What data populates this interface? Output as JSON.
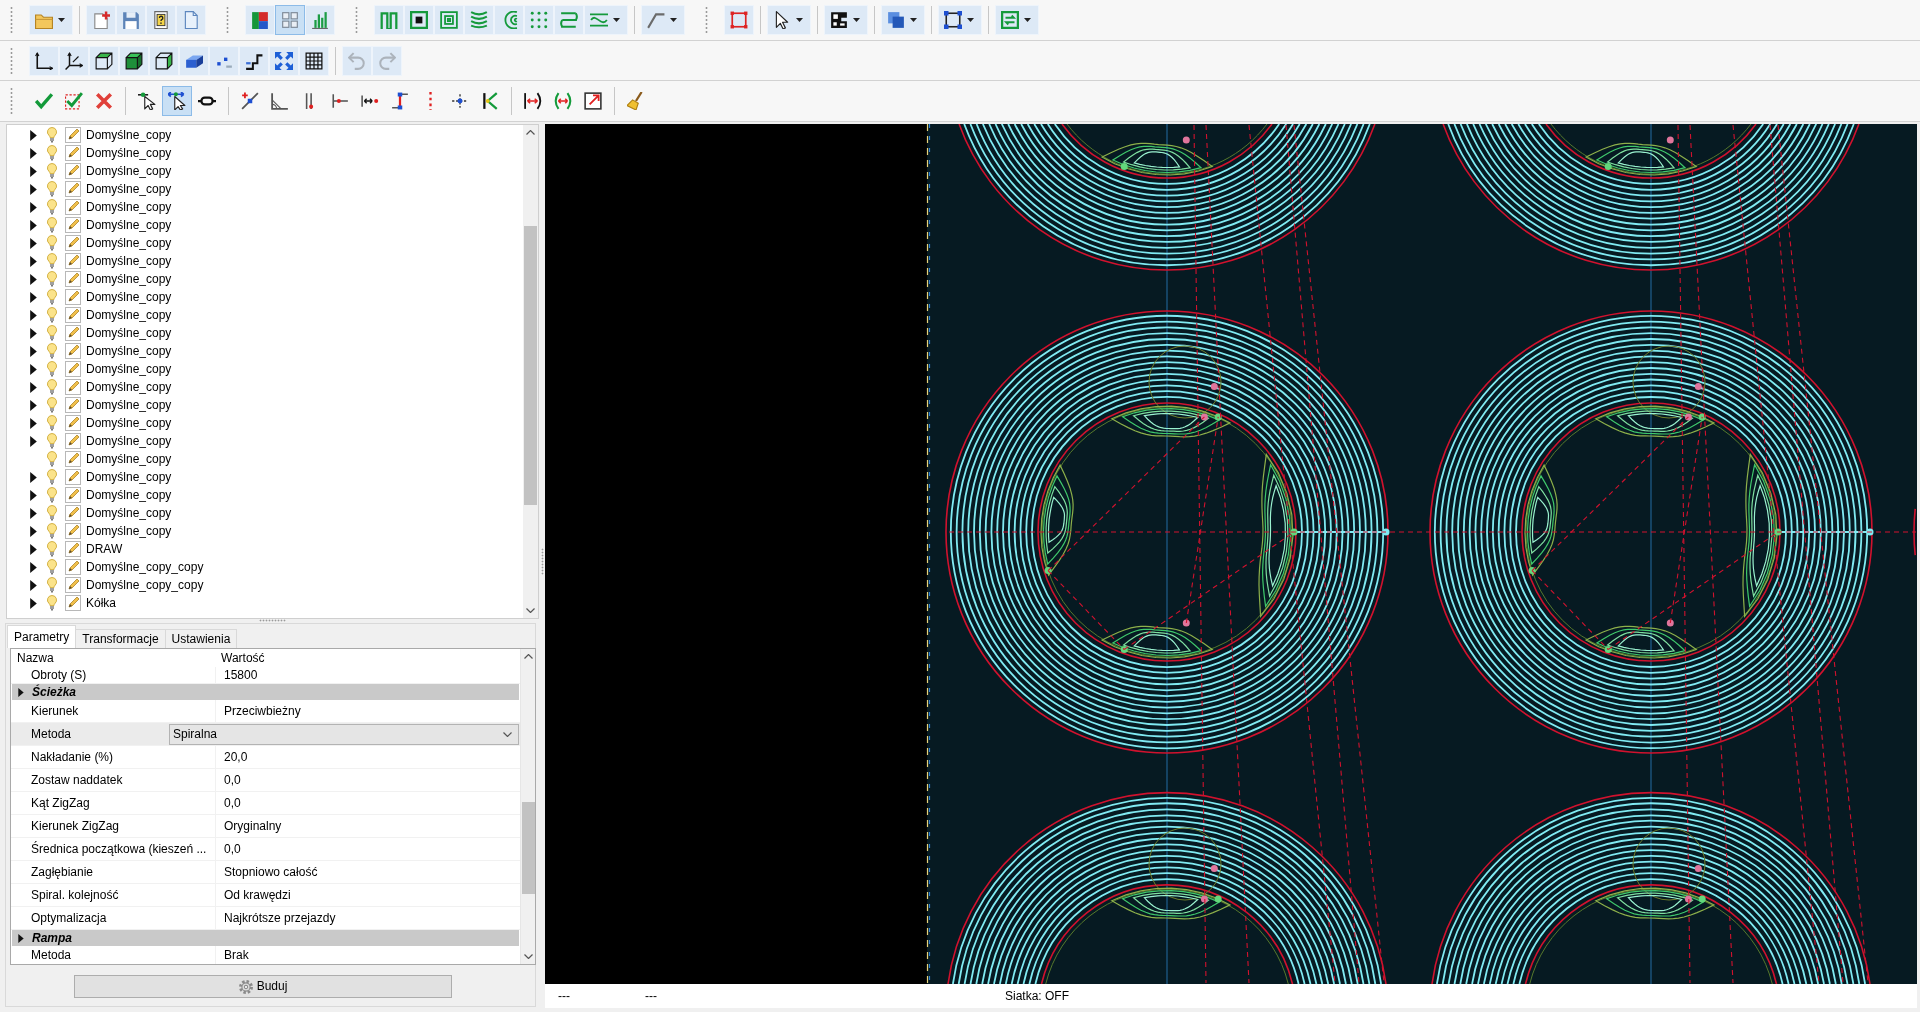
{
  "toolbar_rows": [
    {
      "toolbars": [
        {
          "groups": [
            [
              {
                "kind": "split",
                "disabled": false
              }
            ],
            [
              {
                "kind": "plain",
                "disabled": false
              },
              {
                "kind": "plain",
                "disabled": false
              },
              {
                "kind": "plain",
                "disabled": false
              },
              {
                "kind": "plain",
                "disabled": false
              }
            ]
          ]
        },
        {
          "groups": [
            [
              {
                "kind": "toggle",
                "pressed": false,
                "disabled": false
              },
              {
                "kind": "toggle",
                "pressed": true,
                "disabled": false
              },
              {
                "kind": "toggle",
                "pressed": false,
                "disabled": false
              }
            ]
          ]
        },
        {
          "groups": [
            [
              {
                "kind": "plain",
                "disabled": false
              },
              {
                "kind": "plain",
                "disabled": false
              },
              {
                "kind": "plain",
                "disabled": false
              },
              {
                "kind": "plain",
                "disabled": false
              },
              {
                "kind": "plain",
                "disabled": false
              },
              {
                "kind": "plain",
                "disabled": false
              },
              {
                "kind": "plain",
                "disabled": false
              },
              {
                "kind": "split",
                "disabled": false
              }
            ],
            [
              {
                "kind": "split",
                "disabled": false
              }
            ]
          ]
        },
        {
          "groups": [
            [
              {
                "kind": "plain",
                "disabled": false
              }
            ],
            [
              {
                "kind": "split",
                "disabled": false
              }
            ],
            [
              {
                "kind": "split",
                "disabled": false
              }
            ],
            [
              {
                "kind": "split",
                "disabled": false
              }
            ],
            [
              {
                "kind": "split",
                "disabled": false
              }
            ],
            [
              {
                "kind": "split",
                "disabled": false
              }
            ]
          ]
        }
      ]
    },
    {
      "toolbars": [
        {
          "groups": [
            [
              {
                "kind": "plain",
                "disabled": false
              },
              {
                "kind": "plain",
                "disabled": false
              },
              {
                "kind": "plain",
                "disabled": false
              },
              {
                "kind": "plain",
                "disabled": false
              },
              {
                "kind": "plain",
                "disabled": false
              },
              {
                "kind": "plain",
                "disabled": false
              },
              {
                "kind": "plain",
                "disabled": false
              },
              {
                "kind": "plain",
                "disabled": false
              },
              {
                "kind": "plain",
                "disabled": false
              },
              {
                "kind": "plain",
                "disabled": false
              }
            ],
            [
              {
                "kind": "plain",
                "disabled": true
              },
              {
                "kind": "plain",
                "disabled": true
              }
            ]
          ]
        }
      ]
    },
    {
      "toolbars": [
        {
          "groups": [
            [
              {
                "kind": "plain",
                "disabled": false
              },
              {
                "kind": "plain",
                "disabled": false
              },
              {
                "kind": "plain",
                "disabled": false
              }
            ],
            [
              {
                "kind": "toggle",
                "pressed": false,
                "disabled": false
              },
              {
                "kind": "toggle",
                "pressed": true,
                "disabled": false
              },
              {
                "kind": "toggle",
                "pressed": false,
                "disabled": false
              }
            ],
            [
              {
                "kind": "plain",
                "disabled": false
              },
              {
                "kind": "plain",
                "disabled": false
              },
              {
                "kind": "plain",
                "disabled": false
              },
              {
                "kind": "plain",
                "disabled": false
              },
              {
                "kind": "plain",
                "disabled": false
              },
              {
                "kind": "plain",
                "disabled": false
              },
              {
                "kind": "plain",
                "disabled": false
              },
              {
                "kind": "plain",
                "disabled": false
              },
              {
                "kind": "plain",
                "disabled": false
              }
            ],
            [
              {
                "kind": "plain",
                "disabled": false
              },
              {
                "kind": "plain",
                "disabled": false
              },
              {
                "kind": "plain",
                "disabled": false
              }
            ],
            [
              {
                "kind": "plain",
                "disabled": false
              }
            ]
          ]
        }
      ]
    }
  ],
  "tree": {
    "items": [
      {
        "label": "Domyślne_copy",
        "expandable": true,
        "visible": true
      },
      {
        "label": "Domyślne_copy",
        "expandable": true,
        "visible": true
      },
      {
        "label": "Domyślne_copy",
        "expandable": true,
        "visible": true
      },
      {
        "label": "Domyślne_copy",
        "expandable": true,
        "visible": true
      },
      {
        "label": "Domyślne_copy",
        "expandable": true,
        "visible": true
      },
      {
        "label": "Domyślne_copy",
        "expandable": true,
        "visible": true
      },
      {
        "label": "Domyślne_copy",
        "expandable": true,
        "visible": true
      },
      {
        "label": "Domyślne_copy",
        "expandable": true,
        "visible": true
      },
      {
        "label": "Domyślne_copy",
        "expandable": true,
        "visible": true
      },
      {
        "label": "Domyślne_copy",
        "expandable": true,
        "visible": true
      },
      {
        "label": "Domyślne_copy",
        "expandable": true,
        "visible": true
      },
      {
        "label": "Domyślne_copy",
        "expandable": true,
        "visible": true
      },
      {
        "label": "Domyślne_copy",
        "expandable": true,
        "visible": true
      },
      {
        "label": "Domyślne_copy",
        "expandable": true,
        "visible": true
      },
      {
        "label": "Domyślne_copy",
        "expandable": true,
        "visible": true
      },
      {
        "label": "Domyślne_copy",
        "expandable": true,
        "visible": true
      },
      {
        "label": "Domyślne_copy",
        "expandable": true,
        "visible": true
      },
      {
        "label": "Domyślne_copy",
        "expandable": true,
        "visible": true
      },
      {
        "label": "Domyślne_copy",
        "expandable": false,
        "visible": true
      },
      {
        "label": "Domyślne_copy",
        "expandable": true,
        "visible": true
      },
      {
        "label": "Domyślne_copy",
        "expandable": true,
        "visible": true
      },
      {
        "label": "Domyślne_copy",
        "expandable": true,
        "visible": true
      },
      {
        "label": "Domyślne_copy",
        "expandable": true,
        "visible": true
      },
      {
        "label": "DRAW",
        "expandable": true,
        "visible": true
      },
      {
        "label": "Domyślne_copy_copy",
        "expandable": true,
        "visible": true
      },
      {
        "label": "Domyślne_copy_copy",
        "expandable": true,
        "visible": true
      },
      {
        "label": "Kółka",
        "expandable": true,
        "visible": true
      }
    ]
  },
  "tabs": [
    {
      "label": "Parametry",
      "selected": true
    },
    {
      "label": "Transformacje",
      "selected": false
    },
    {
      "label": "Ustawienia",
      "selected": false
    }
  ],
  "properties": {
    "columns": [
      "Nazwa",
      "Wartość"
    ],
    "rows": [
      {
        "kind": "property",
        "name": "Obroty (S)",
        "value": "15800",
        "selected": false
      },
      {
        "kind": "category",
        "name": "Ścieżka",
        "selected": false
      },
      {
        "kind": "property",
        "name": "Kierunek",
        "value": "Przeciwbieżny",
        "selected": false
      },
      {
        "kind": "combo",
        "name": "Metoda",
        "value": "Spiralna",
        "selected": true
      },
      {
        "kind": "property",
        "name": "Nakładanie (%)",
        "value": "20,0",
        "selected": false
      },
      {
        "kind": "property",
        "name": "Zostaw naddatek",
        "value": "0,0",
        "selected": false
      },
      {
        "kind": "property",
        "name": "Kąt ZigZag",
        "value": "0,0",
        "selected": false
      },
      {
        "kind": "property",
        "name": "Kierunek ZigZag",
        "value": "Oryginalny",
        "selected": false
      },
      {
        "kind": "property",
        "name": "Średnica początkowa (kieszeń ...",
        "value": "0,0",
        "selected": false
      },
      {
        "kind": "property",
        "name": "Zagłębianie",
        "value": "Stopniowo całość",
        "selected": false
      },
      {
        "kind": "property",
        "name": "Spiral. kolejność",
        "value": "Od krawędzi",
        "selected": false
      },
      {
        "kind": "property",
        "name": "Optymalizacja",
        "value": "Najkrótsze przejazdy",
        "selected": false
      },
      {
        "kind": "category",
        "name": "Rampa",
        "selected": false
      },
      {
        "kind": "property",
        "name": "Metoda",
        "value": "Brak",
        "selected": false
      }
    ]
  },
  "build_button": "Buduj",
  "status_bar": [
    "---",
    "---",
    "Siatka: OFF"
  ]
}
